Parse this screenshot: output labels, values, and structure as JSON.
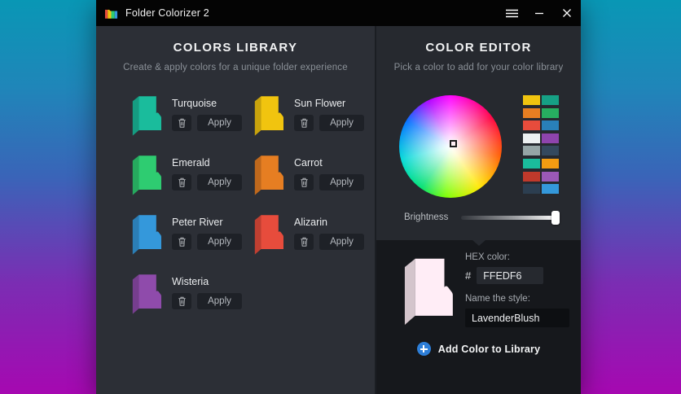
{
  "titlebar": {
    "title": "Folder Colorizer 2"
  },
  "library": {
    "title": "COLORS LIBRARY",
    "subtitle": "Create & apply colors for a unique folder experience",
    "apply_label": "Apply",
    "colors": [
      {
        "name": "Turquoise",
        "hex": "#1abc9c"
      },
      {
        "name": "Sun Flower",
        "hex": "#f1c40f"
      },
      {
        "name": "Emerald",
        "hex": "#2ecc71"
      },
      {
        "name": "Carrot",
        "hex": "#e67e22"
      },
      {
        "name": "Peter River",
        "hex": "#3498db"
      },
      {
        "name": "Alizarin",
        "hex": "#e74c3c"
      },
      {
        "name": "Wisteria",
        "hex": "#8f4bab"
      }
    ]
  },
  "editor": {
    "title": "COLOR EDITOR",
    "subtitle": "Pick a color to add for your color library",
    "brightness_label": "Brightness",
    "swatches": [
      "#f1c40f",
      "#16a085",
      "#e67e22",
      "#27ae60",
      "#e74c3c",
      "#2980b9",
      "#ecf0f1",
      "#8e44ad",
      "#95a5a6",
      "#34495e",
      "#1abc9c",
      "#f39c12",
      "#c0392b",
      "#9b59b6",
      "#2c3e50",
      "#3498db"
    ],
    "hex_label": "HEX color:",
    "hex_prefix": "#",
    "hex_value": "FFEDF6",
    "name_label": "Name the style:",
    "name_value": "LavenderBlush",
    "preview_color": "#FFEDF6",
    "add_button": "Add Color to Library"
  }
}
